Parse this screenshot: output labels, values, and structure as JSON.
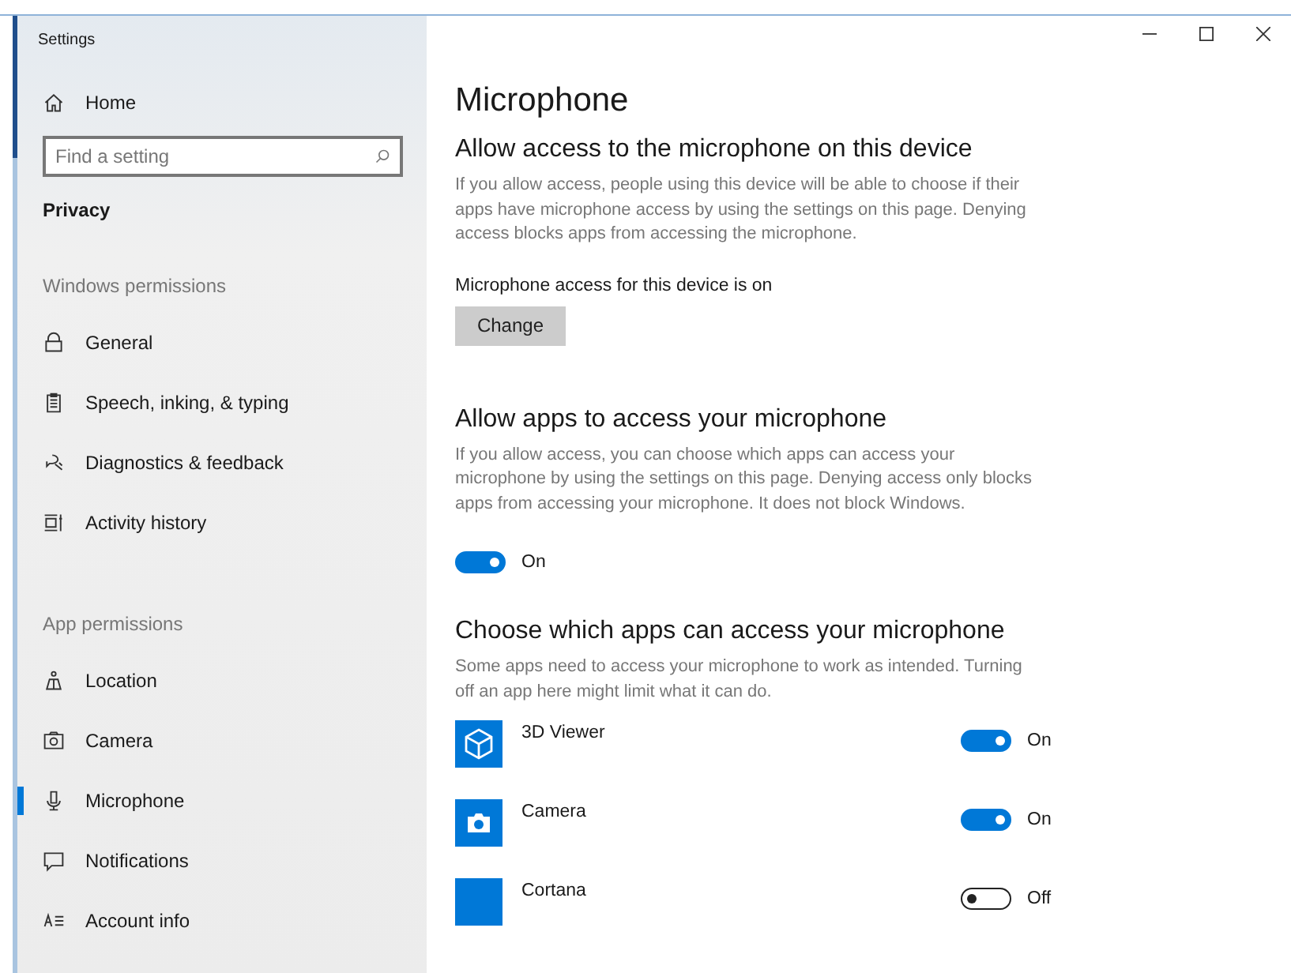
{
  "window": {
    "title": "Settings"
  },
  "sidebar": {
    "home": "Home",
    "search": {
      "placeholder": "Find a setting"
    },
    "category": "Privacy",
    "groups": [
      {
        "heading": "Windows permissions",
        "items": [
          {
            "label": "General",
            "selected": false
          },
          {
            "label": "Speech, inking, & typing",
            "selected": false
          },
          {
            "label": "Diagnostics & feedback",
            "selected": false
          },
          {
            "label": "Activity history",
            "selected": false
          }
        ]
      },
      {
        "heading": "App permissions",
        "items": [
          {
            "label": "Location",
            "selected": false
          },
          {
            "label": "Camera",
            "selected": false
          },
          {
            "label": "Microphone",
            "selected": true
          },
          {
            "label": "Notifications",
            "selected": false
          },
          {
            "label": "Account info",
            "selected": false
          }
        ]
      }
    ]
  },
  "page": {
    "title": "Microphone",
    "device_section": {
      "heading": "Allow access to the microphone on this device",
      "description": "If you allow access, people using this device will be able to choose if their apps have microphone access by using the settings on this page. Denying access blocks apps from accessing the microphone.",
      "status": "Microphone access for this device is on",
      "button": "Change"
    },
    "apps_section": {
      "heading": "Allow apps to access your microphone",
      "description": "If you allow access, you can choose which apps can access your microphone by using the settings on this page. Denying access only blocks apps from accessing your microphone. It does not block Windows.",
      "toggle": {
        "on": true,
        "label": "On"
      }
    },
    "choose_section": {
      "heading": "Choose which apps can access your microphone",
      "description": "Some apps need to access your microphone to work as intended. Turning off an app here might limit what it can do.",
      "apps": [
        {
          "name": "3D Viewer",
          "on": true,
          "label": "On"
        },
        {
          "name": "Camera",
          "on": true,
          "label": "On"
        },
        {
          "name": "Cortana",
          "on": false,
          "label": "Off"
        }
      ]
    }
  }
}
